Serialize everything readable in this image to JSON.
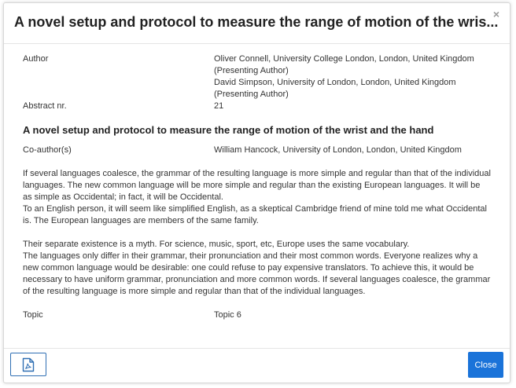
{
  "modal": {
    "title": "A novel setup and protocol to measure the range of motion of the wris...",
    "close_glyph": "×"
  },
  "details": {
    "author_label": "Author",
    "authors": [
      {
        "line1": "Oliver Connell, University College London, London, United Kingdom",
        "line2": "(Presenting Author)"
      },
      {
        "line1": "David Simpson, University of London, London, United Kingdom",
        "line2": "(Presenting Author)"
      }
    ],
    "abstract_label": "Abstract nr.",
    "abstract_value": "21",
    "full_title": "A novel setup and protocol to measure the range of motion of the wrist and the hand",
    "coauthor_label": "Co-author(s)",
    "coauthor_value": "William Hancock, University of London, London, United Kingdom",
    "paragraphs": [
      "If several languages coalesce, the grammar of the resulting language is more simple and regular than that of the individual languages. The new common language will be more simple and regular than the existing European languages. It will be as simple as Occidental; in fact, it will be Occidental.",
      "To an English person, it will seem like simplified English, as a skeptical Cambridge friend of mine told me what Occidental is. The European languages are members of the same family.",
      "Their separate existence is a myth. For science, music, sport, etc, Europe uses the same vocabulary.",
      "The languages only differ in their grammar, their pronunciation and their most common words. Everyone realizes why a new common language would be desirable: one could refuse to pay expensive translators. To achieve this, it would be necessary to have uniform grammar, pronunciation and more common words. If several languages coalesce, the grammar of the resulting language is more simple and regular than that of the individual languages."
    ],
    "topic_label": "Topic",
    "topic_value": "Topic 6"
  },
  "footer": {
    "pdf_icon": "pdf-file-icon",
    "close_label": "Close"
  },
  "colors": {
    "primary": "#1a73d9",
    "pdf_border": "#2f6fb3",
    "text": "#333333"
  }
}
